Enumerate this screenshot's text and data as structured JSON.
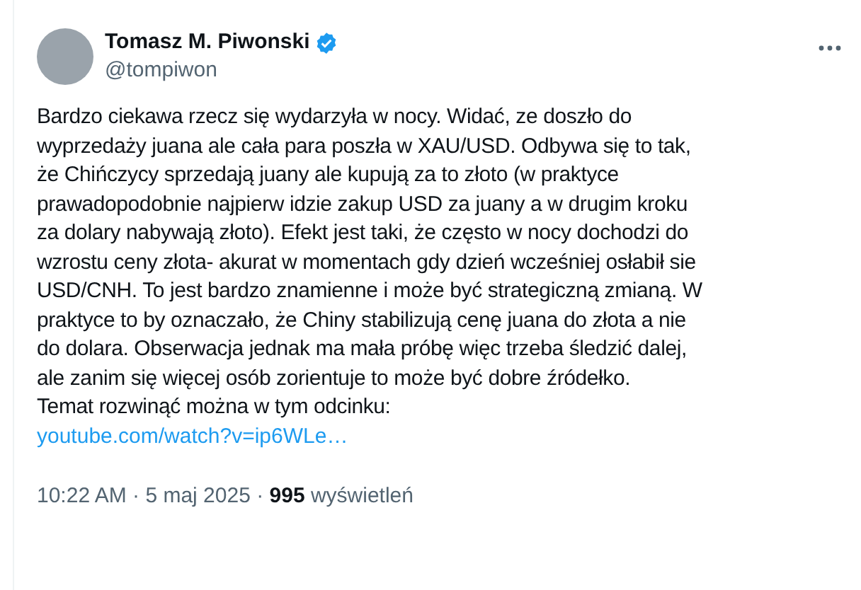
{
  "author": {
    "name": "Tomasz M. Piwonski",
    "verified": true,
    "handle": "@tompiwon"
  },
  "body": "Bardzo ciekawa rzecz się wydarzyła w nocy. Widać, ze doszło do\nwyprzedaży juana ale cała para poszła w XAU/USD. Odbywa się to tak,\nże Chińczycy sprzedają juany ale kupują za to złoto (w praktyce\nprawadopodobnie najpierw idzie zakup USD za juany a w drugim kroku\nza dolary nabywają złoto). Efekt jest taki, że często w nocy dochodzi do\nwzrostu ceny złota- akurat w momentach gdy dzień wcześniej osłabił sie\nUSD/CNH. To jest bardzo znamienne i może być strategiczną zmianą. W\npraktyce to by oznaczało, że Chiny stabilizują cenę juana do złota a nie\ndo dolara. Obserwacja jednak ma mała próbę więc trzeba śledzić dalej,\nale zanim się więcej osób zorientuje to może być dobre źródełko.\nTemat rozwinąć można w tym odcinku:",
  "link": "youtube.com/watch?v=ip6WLe…",
  "meta": "10:22 AM · 5 maj 2025 · **995** wyświetleń"
}
